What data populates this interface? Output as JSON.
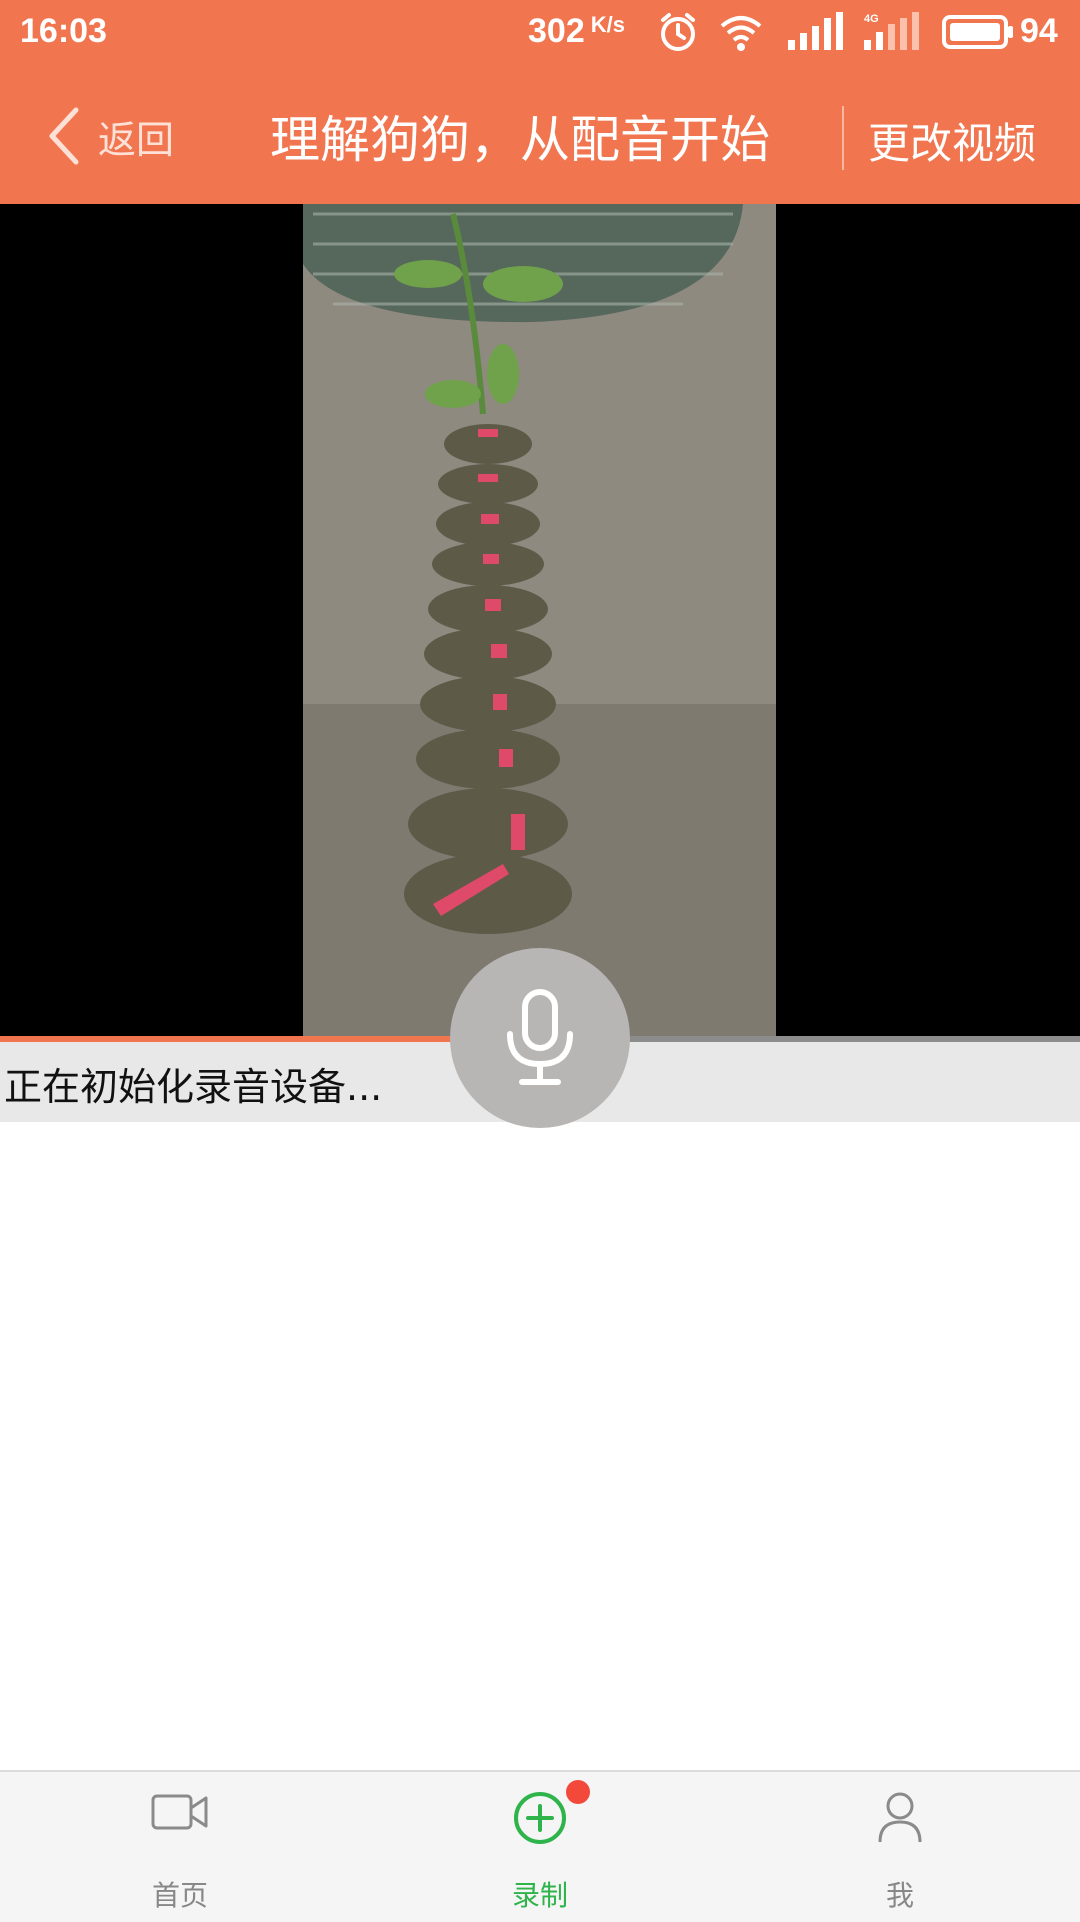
{
  "status_bar": {
    "time": "16:03",
    "net_speed": "302",
    "net_unit": "K/s",
    "battery": "94"
  },
  "header": {
    "back_label": "返回",
    "title": "理解狗狗，从配音开始",
    "change_video": "更改视频"
  },
  "player": {
    "progress_fraction": 0.42
  },
  "recording": {
    "status_text": "正在初始化录音设备..."
  },
  "tabbar": {
    "tabs": [
      {
        "label": "首页",
        "icon": "video-camera-icon"
      },
      {
        "label": "录制",
        "icon": "plus-circle-icon"
      },
      {
        "label": "我",
        "icon": "person-icon"
      }
    ]
  },
  "colors": {
    "accent": "#f17650",
    "active_tab": "#2fb34b",
    "badge": "#f2493b"
  }
}
